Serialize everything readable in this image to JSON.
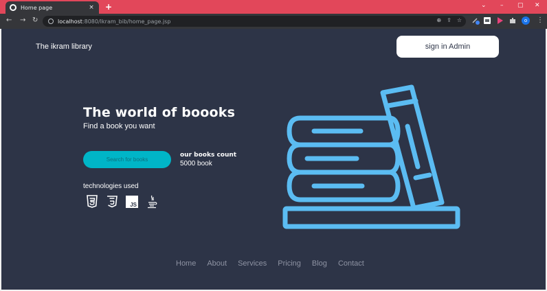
{
  "browser": {
    "tab_title": "Home page",
    "tab_close": "×",
    "new_tab": "+",
    "url_host": "localhost",
    "url_path": ":8080/Ikram_bib/home_page.jsp",
    "profile_initial": "o",
    "window_controls": [
      "⌄",
      "–",
      "▢",
      "✕"
    ]
  },
  "header": {
    "brand": "The ikram library",
    "signin_label": "sign in Admin"
  },
  "hero": {
    "title": "The world of boooks",
    "subtitle": "Find a book you want",
    "search_button": "Search for books",
    "count_label": "our books count",
    "count_value": "5000 book",
    "tech_label": "technologies used",
    "tech_icons": [
      "html5-icon",
      "css3-icon",
      "javascript-icon",
      "java-icon"
    ],
    "tech_icon_js_text": "JS"
  },
  "footer": {
    "links": [
      "Home",
      "About",
      "Services",
      "Pricing",
      "Blog",
      "Contact"
    ]
  },
  "colors": {
    "page_bg": "#2d3447",
    "accent": "#00b5c7",
    "illustration": "#5bbcf2",
    "tabstrip": "#e2475a"
  }
}
